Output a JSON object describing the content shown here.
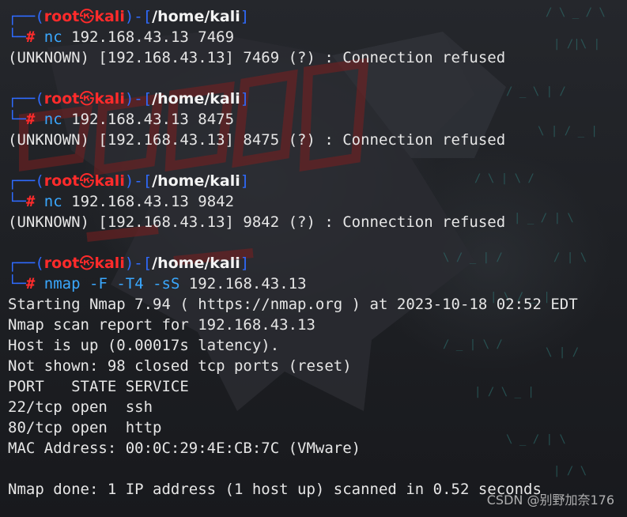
{
  "prompt": {
    "open": "┌──(",
    "user": "root",
    "at_symbol": "㉿",
    "host": "kali",
    "mid": ")-[",
    "path": "/home/kali",
    "close": "]",
    "second_line": "└─",
    "hash": "#"
  },
  "blocks": [
    {
      "cmd": "nc",
      "args": " 192.168.43.13 7469",
      "output": [
        "(UNKNOWN) [192.168.43.13] 7469 (?) : Connection refused"
      ]
    },
    {
      "cmd": "nc",
      "args": " 192.168.43.13 8475",
      "output": [
        "(UNKNOWN) [192.168.43.13] 8475 (?) : Connection refused"
      ]
    },
    {
      "cmd": "nc",
      "args": " 192.168.43.13 9842",
      "output": [
        "(UNKNOWN) [192.168.43.13] 9842 (?) : Connection refused"
      ]
    },
    {
      "cmd": "nmap",
      "flags": " -F -T4 -sS",
      "args": " 192.168.43.13",
      "output": [
        "Starting Nmap 7.94 ( https://nmap.org ) at 2023-10-18 02:52 EDT",
        "Nmap scan report for 192.168.43.13",
        "Host is up (0.00017s latency).",
        "Not shown: 98 closed tcp ports (reset)",
        "PORT   STATE SERVICE",
        "22/tcp open  ssh",
        "80/tcp open  http",
        "MAC Address: 00:0C:29:4E:CB:7C (VMware)",
        "",
        "Nmap done: 1 IP address (1 host up) scanned in 0.52 seconds"
      ]
    }
  ],
  "watermark": "CSDN @别野加奈176",
  "colors": {
    "prompt_frame": "#2f6bff",
    "user_host": "#ff2b2b",
    "command": "#3aa8ff",
    "text": "#e6e6e6",
    "background": "#1e2024"
  }
}
